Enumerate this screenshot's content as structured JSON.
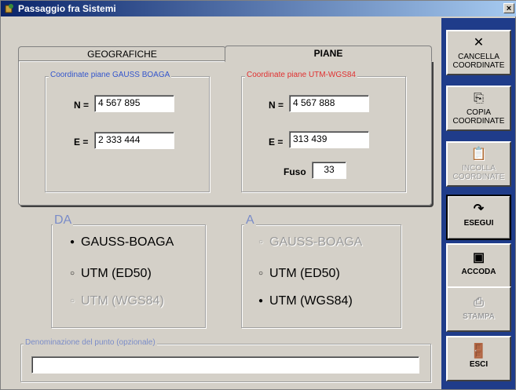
{
  "window": {
    "title": "Passaggio fra Sistemi",
    "close_label": "×"
  },
  "tabs": [
    {
      "label": "GEOGRAFICHE",
      "active": false
    },
    {
      "label": "PIANE",
      "active": true
    }
  ],
  "gauss": {
    "legend": "Coordinate piane GAUSS BOAGA",
    "n_label": "N =",
    "n_value": "4 567 895",
    "e_label": "E =",
    "e_value": "2 333 444"
  },
  "utm": {
    "legend": "Coordinate piane UTM-WGS84",
    "n_label": "N =",
    "n_value": "4 567 888",
    "e_label": "E =",
    "e_value": "313 439",
    "fuso_label": "Fuso",
    "fuso_value": "33"
  },
  "from": {
    "legend": "DA",
    "options": [
      {
        "label": "GAUSS-BOAGA",
        "selected": true,
        "enabled": true
      },
      {
        "label": "UTM (ED50)",
        "selected": false,
        "enabled": true
      },
      {
        "label": "UTM (WGS84)",
        "selected": false,
        "enabled": false
      }
    ]
  },
  "to": {
    "legend": "A",
    "options": [
      {
        "label": "GAUSS-BOAGA",
        "selected": false,
        "enabled": false
      },
      {
        "label": "UTM (ED50)",
        "selected": false,
        "enabled": true
      },
      {
        "label": "UTM (WGS84)",
        "selected": true,
        "enabled": true
      }
    ]
  },
  "point_name": {
    "legend": "Denominazione del punto (opzionale)",
    "value": ""
  },
  "sidebar": {
    "cancella": {
      "line1": "CANCELLA",
      "line2": "COORDINATE",
      "icon": "x-icon"
    },
    "copia": {
      "line1": "COPIA",
      "line2": "COORDINATE",
      "icon": "copy-icon"
    },
    "incolla": {
      "line1": "INCOLLA",
      "line2": "COORDINATE",
      "icon": "paste-icon"
    },
    "esegui": {
      "label": "ESEGUI",
      "icon": "redo-icon"
    },
    "accoda": {
      "label": "ACCODA",
      "icon": "printer-icon"
    },
    "stampa": {
      "label": "STAMPA",
      "icon": "printer-icon"
    },
    "esci": {
      "label": "ESCI",
      "icon": "exit-door-icon"
    }
  },
  "colors": {
    "gauss_legend": "#3355cc",
    "utm_legend": "#e03030",
    "sidebar_bg": "#1f3c8a",
    "groupbox_legend": "#7a8cc8"
  }
}
